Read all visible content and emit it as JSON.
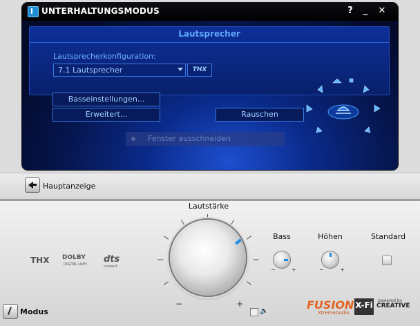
{
  "window": {
    "title": "UNTERHALTUNGSMODUS",
    "help_label": "?",
    "minimize_label": "_",
    "close_label": "✕"
  },
  "speakers": {
    "section_title": "Lautsprecher",
    "config_label": "Lautsprecherkonfiguration:",
    "config_value": "7.1 Lautsprecher",
    "thx_label": "THX",
    "bass_settings_label": "Basseinstellungen...",
    "advanced_label": "Erweitert...",
    "noise_label": "Rauschen",
    "cutout_label": "Fenster ausschneiden"
  },
  "nav": {
    "main_display_label": "Hauptanzeige",
    "mode_label": "Modus"
  },
  "controls": {
    "volume_label": "Lautstärke",
    "volume_minus": "−",
    "volume_plus": "+",
    "bass_label": "Bass",
    "treble_label": "Höhen",
    "standard_label": "Standard",
    "knob_minus": "−",
    "knob_plus": "+"
  },
  "logos": {
    "thx": "THX",
    "dolby": "DOLBY",
    "dolby_sub": "DIGITAL LIVE!",
    "dts": "dts",
    "dts_sub": "connect",
    "fusion": "FUSION",
    "fusion_sub": "XtremeAudio",
    "xfi": "X-Fi",
    "creative": "CREATIVE",
    "powered_by": "powered by"
  },
  "icons": [
    "app-logo-icon",
    "back-arrow-icon",
    "speaker-layout-icon",
    "mute-icon",
    "mode-icon"
  ],
  "colors": {
    "panel_dark": "#061650",
    "accent_blue": "#1e8be5",
    "label_blue": "#6fb4ff",
    "fusion_orange": "#e3621f"
  }
}
